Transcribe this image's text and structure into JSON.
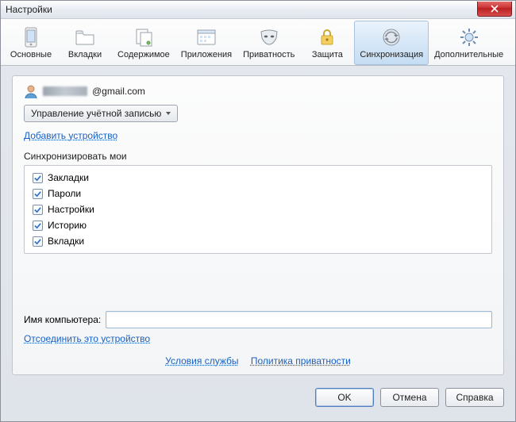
{
  "window": {
    "title": "Настройки"
  },
  "tabs": [
    {
      "label": "Основные"
    },
    {
      "label": "Вкладки"
    },
    {
      "label": "Содержимое"
    },
    {
      "label": "Приложения"
    },
    {
      "label": "Приватность"
    },
    {
      "label": "Защита"
    },
    {
      "label": "Синхронизация"
    },
    {
      "label": "Дополнительные"
    }
  ],
  "account": {
    "email_suffix": "@gmail.com",
    "manage_label": "Управление учётной записью",
    "add_device_label": "Добавить устройство"
  },
  "sync": {
    "section_label": "Синхронизировать мои",
    "items": [
      {
        "label": "Закладки",
        "checked": true
      },
      {
        "label": "Пароли",
        "checked": true
      },
      {
        "label": "Настройки",
        "checked": true
      },
      {
        "label": "Историю",
        "checked": true
      },
      {
        "label": "Вкладки",
        "checked": true
      }
    ]
  },
  "computer": {
    "label": "Имя компьютера:",
    "value": "",
    "detach_label": "Отсоединить это устройство"
  },
  "footer": {
    "terms": "Условия службы",
    "privacy": "Политика приватности"
  },
  "buttons": {
    "ok": "OK",
    "cancel": "Отмена",
    "help": "Справка"
  }
}
